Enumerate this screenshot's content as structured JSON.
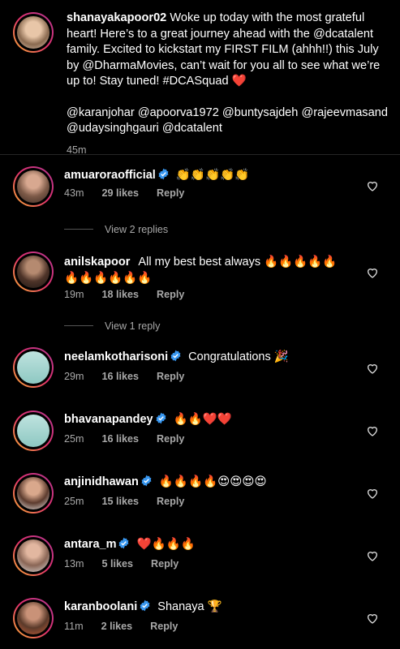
{
  "post": {
    "username": "shanayakapoor02",
    "caption": "Woke up today with the most grateful heart! Here’s to a great journey ahead with the @dcatalent family. Excited to kickstart my FIRST FILM (ahhh!!) this July by @DharmaMovies, can’t wait for you all to see what we’re up to! Stay tuned! #DCASquad ❤️",
    "tags": "@karanjohar @apoorva1972 @buntysajdeh @rajeevmasand @udaysinghgauri @dcatalent",
    "time": "45m"
  },
  "comments": [
    {
      "username": "amuaroraofficial",
      "text": "👏👏👏👏👏",
      "time": "43m",
      "likes": "29 likes",
      "reply": "Reply",
      "verified": true
    },
    {
      "username": "anilskapoor",
      "text": "All my best best always 🔥🔥🔥🔥🔥🔥🔥🔥🔥🔥🔥",
      "time": "19m",
      "likes": "18 likes",
      "reply": "Reply",
      "verified": false
    },
    {
      "username": "neelamkotharisoni",
      "text": "Congratulations 🎉",
      "time": "29m",
      "likes": "16 likes",
      "reply": "Reply",
      "verified": true
    },
    {
      "username": "bhavanapandey",
      "text": "🔥🔥❤️❤️",
      "time": "25m",
      "likes": "16 likes",
      "reply": "Reply",
      "verified": true
    },
    {
      "username": "anjinidhawan",
      "text": "🔥🔥🔥🔥😍😍😍😍",
      "time": "25m",
      "likes": "15 likes",
      "reply": "Reply",
      "verified": true
    },
    {
      "username": "antara_m",
      "text": "❤️🔥🔥🔥",
      "time": "13m",
      "likes": "5 likes",
      "reply": "Reply",
      "verified": true
    },
    {
      "username": "karanboolani",
      "text": "Shanaya 🏆",
      "time": "11m",
      "likes": "2 likes",
      "reply": "Reply",
      "verified": true
    }
  ],
  "view_replies": [
    "View 2 replies",
    "View 1 reply"
  ],
  "colors": {
    "verified": "#3897f0",
    "meta": "#a8a8a8"
  },
  "icons": {
    "heart": "heart-outline-icon",
    "verified": "verified-badge-icon"
  }
}
